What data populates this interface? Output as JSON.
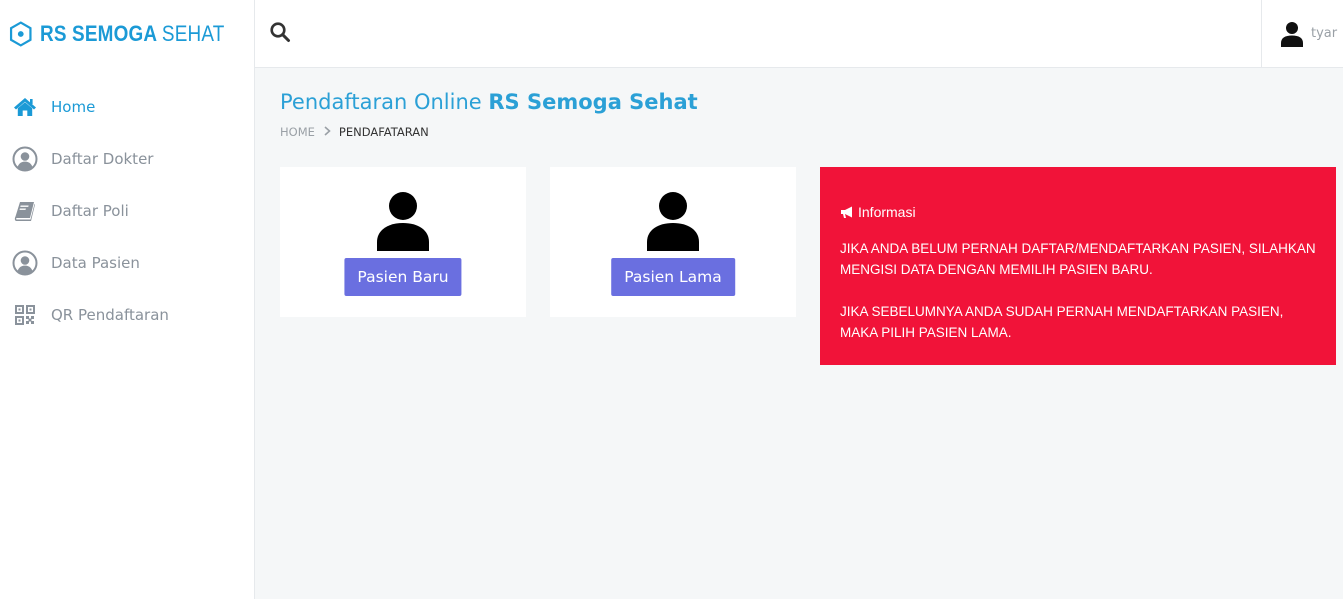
{
  "brand": {
    "name_bold": "RS SEMOGA",
    "name_thin": "SEHAT",
    "color": "#1b9ad6"
  },
  "sidebar": {
    "items": [
      {
        "label": "Home",
        "icon": "home-icon",
        "active": true
      },
      {
        "label": "Daftar Dokter",
        "icon": "user-circle-icon",
        "active": false
      },
      {
        "label": "Daftar Poli",
        "icon": "book-icon",
        "active": false
      },
      {
        "label": "Data Pasien",
        "icon": "user-circle-icon",
        "active": false
      },
      {
        "label": "QR Pendaftaran",
        "icon": "qrcode-icon",
        "active": false
      }
    ]
  },
  "topbar": {
    "search_icon": "search-icon",
    "user": {
      "name": "tyar",
      "icon": "user-icon"
    }
  },
  "page": {
    "title_prefix": "Pendaftaran Online",
    "title_strong": "RS Semoga Sehat",
    "breadcrumb": {
      "home": "HOME",
      "current": "PENDAFATARAN"
    }
  },
  "cards": [
    {
      "icon": "user-icon",
      "button_label": "Pasien Baru"
    },
    {
      "icon": "user-icon",
      "button_label": "Pasien Lama"
    }
  ],
  "info": {
    "icon": "bullhorn-icon",
    "title": "Informasi",
    "paragraphs": [
      "JIKA ANDA BELUM PERNAH DAFTAR/MENDAFTARKAN PASIEN, SILAHKAN MENGISI DATA DENGAN MEMILIH PASIEN BARU.",
      "JIKA SEBELUMNYA ANDA SUDAH PERNAH MENDAFTARKAN PASIEN, MAKA PILIH PASIEN LAMA."
    ],
    "color": "#f11339"
  },
  "colors": {
    "accent": "#1b9ad6",
    "button": "#6a6fe0",
    "muted": "#8a929b"
  }
}
